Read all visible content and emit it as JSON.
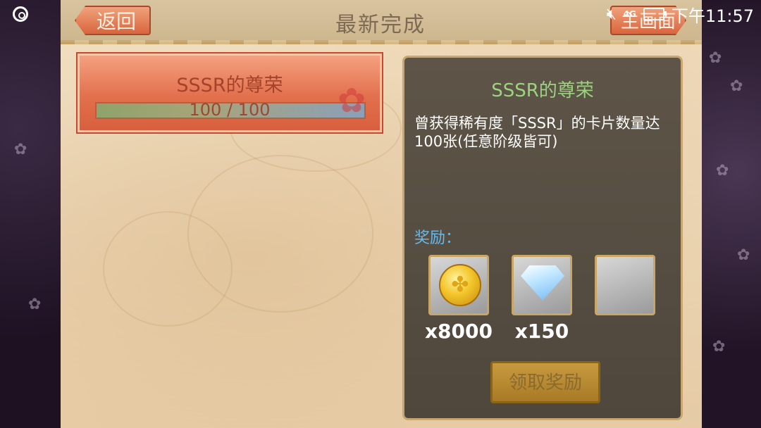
{
  "header": {
    "title": "最新完成",
    "back_label": "返回",
    "home_label": "主画面"
  },
  "status_bar": {
    "network": "4G",
    "time": "下午11:57"
  },
  "achievement": {
    "name": "SSSR的尊荣",
    "progress_text": "100 / 100",
    "progress_fraction": 1.0
  },
  "detail": {
    "title": "SSSR的尊荣",
    "description": "曾获得稀有度「SSSR」的卡片数量达100张(任意阶级皆可)",
    "reward_label": "奖励：",
    "rewards": [
      {
        "icon": "gold-coin-icon",
        "quantity": "x8000"
      },
      {
        "icon": "diamond-icon",
        "quantity": "x150"
      },
      {
        "icon": "empty-slot",
        "quantity": ""
      }
    ],
    "claim_button": "领取奖励"
  },
  "colors": {
    "accent_orange": "#e2704d",
    "title_green": "#9bd37f",
    "reward_blue": "#68b9ea",
    "panel_bg": "#564e42",
    "gold_border": "#c7a66f"
  }
}
